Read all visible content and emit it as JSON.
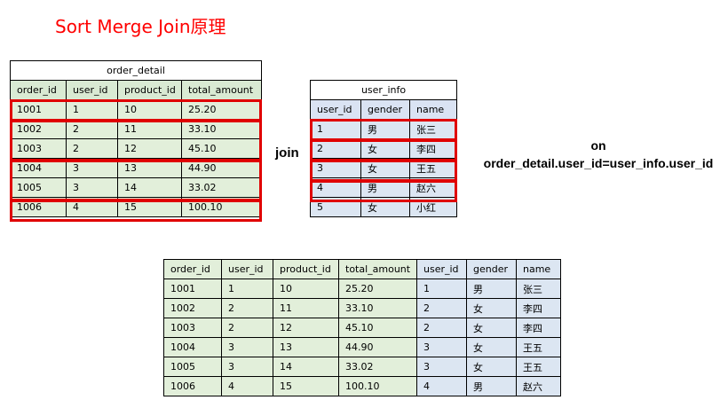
{
  "title": "Sort Merge Join原理",
  "order_detail": {
    "name": "order_detail",
    "columns": [
      "order_id",
      "user_id",
      "product_id",
      "total_amount"
    ],
    "rows": [
      [
        "1001",
        "1",
        "10",
        "25.20"
      ],
      [
        "1002",
        "2",
        "11",
        "33.10"
      ],
      [
        "1003",
        "2",
        "12",
        "45.10"
      ],
      [
        "1004",
        "3",
        "13",
        "44.90"
      ],
      [
        "1005",
        "3",
        "14",
        "33.02"
      ],
      [
        "1006",
        "4",
        "15",
        "100.10"
      ]
    ]
  },
  "user_info": {
    "name": "user_info",
    "columns": [
      "user_id",
      "gender",
      "name"
    ],
    "rows": [
      [
        "1",
        "男",
        "张三"
      ],
      [
        "2",
        "女",
        "李四"
      ],
      [
        "3",
        "女",
        "王五"
      ],
      [
        "4",
        "男",
        "赵六"
      ],
      [
        "5",
        "女",
        "小红"
      ]
    ]
  },
  "join_label": "join",
  "on_label": "on",
  "condition": "order_detail.user_id=user_info.user_id",
  "result": {
    "columns": [
      "order_id",
      "user_id",
      "product_id",
      "total_amount",
      "user_id",
      "gender",
      "name"
    ],
    "rows": [
      [
        "1001",
        "1",
        "10",
        "25.20",
        "1",
        "男",
        "张三"
      ],
      [
        "1002",
        "2",
        "11",
        "33.10",
        "2",
        "女",
        "李四"
      ],
      [
        "1003",
        "2",
        "12",
        "45.10",
        "2",
        "女",
        "李四"
      ],
      [
        "1004",
        "3",
        "13",
        "44.90",
        "3",
        "女",
        "王五"
      ],
      [
        "1005",
        "3",
        "14",
        "33.02",
        "3",
        "女",
        "王五"
      ],
      [
        "1006",
        "4",
        "15",
        "100.10",
        "4",
        "男",
        "赵六"
      ]
    ]
  },
  "colors": {
    "title": "#ff0000",
    "highlight": "#e00000",
    "green": "#e2efda",
    "blue": "#dce6f2"
  }
}
